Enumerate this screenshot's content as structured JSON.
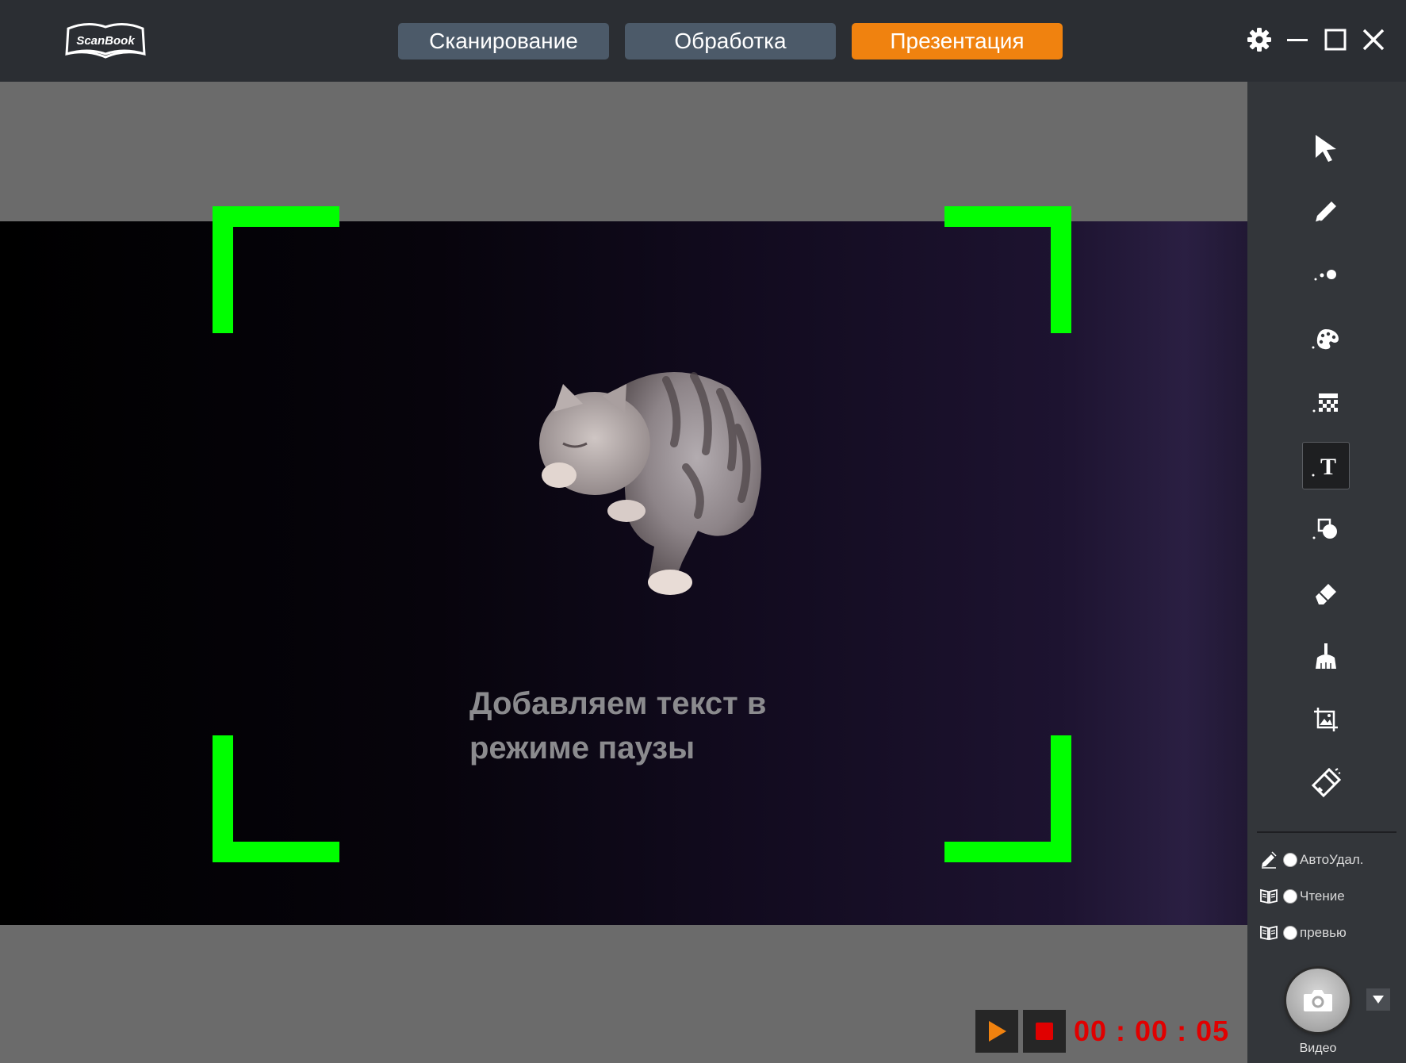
{
  "app": {
    "logo_text": "ScanBook"
  },
  "tabs": [
    {
      "label": "Сканирование",
      "active": false
    },
    {
      "label": "Обработка",
      "active": false
    },
    {
      "label": "Презентация",
      "active": true
    }
  ],
  "window_controls": [
    "gear-icon",
    "minimize-icon",
    "maximize-icon",
    "close-icon"
  ],
  "viewer": {
    "overlay_text_line1": "Добавляем текст в",
    "overlay_text_line2": "режиме паузы",
    "frame_corner_color": "#00ff00"
  },
  "playback": {
    "timer": "00 : 00 : 05"
  },
  "toolbar": {
    "tools": [
      "pointer",
      "pen",
      "laser-dot",
      "palette",
      "mosaic",
      "text",
      "shape",
      "eraser",
      "clear-broom",
      "crop-image",
      "spotlight"
    ],
    "selected_tool": "text"
  },
  "options": [
    {
      "label": "АвтоУдал.",
      "icon": "auto-delete-pen-icon"
    },
    {
      "label": "Чтение",
      "icon": "book-icon"
    },
    {
      "label": "превью",
      "icon": "book-icon"
    }
  ],
  "capture": {
    "label": "Видео",
    "icon": "camera-icon"
  },
  "colors": {
    "accent": "#f0820f",
    "tab": "#4c5a69",
    "timer": "#e00000",
    "topbar": "#2b2e33",
    "sidebar": "#33363a"
  }
}
